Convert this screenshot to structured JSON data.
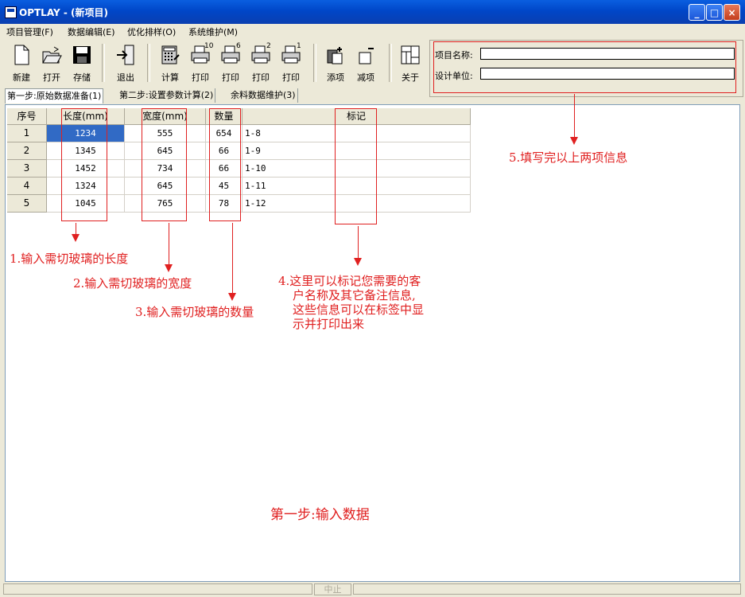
{
  "window": {
    "title": "OPTLAY - (新项目)"
  },
  "menu": [
    "项目管理(F)",
    "数据编辑(E)",
    "优化排样(O)",
    "系统维护(M)"
  ],
  "toolbar": {
    "new": "新建",
    "open": "打开",
    "save": "存储",
    "exit": "退出",
    "calc": "计算",
    "print1": "打印",
    "print2": "打印",
    "print3": "打印",
    "print4": "打印",
    "add": "添项",
    "remove": "减项",
    "about": "关于",
    "print_badges": [
      "10",
      "6",
      "2",
      "1"
    ]
  },
  "project": {
    "name_label": "项目名称:",
    "name_value": "",
    "unit_label": "设计单位:",
    "unit_value": ""
  },
  "tabs": [
    "第一步:原始数据准备(1)",
    "第二步:设置参数计算(2)",
    "余料数据维护(3)"
  ],
  "table": {
    "headers": [
      "序号",
      "长度(mm)",
      "宽度(mm)",
      "数量",
      "",
      "标记"
    ],
    "rows": [
      [
        "1",
        "1234",
        "555",
        "654",
        "1-8",
        ""
      ],
      [
        "2",
        "1345",
        "645",
        "66",
        "1-9",
        ""
      ],
      [
        "3",
        "1452",
        "734",
        "66",
        "1-10",
        ""
      ],
      [
        "4",
        "1324",
        "645",
        "45",
        "1-11",
        ""
      ],
      [
        "5",
        "1045",
        "765",
        "78",
        "1-12",
        ""
      ]
    ]
  },
  "annotations": {
    "length": "1.输入需切玻璃的长度",
    "width": "2.输入需切玻璃的宽度",
    "qty": "3.输入需切玻璃的数量",
    "mark_lines": [
      "4.这里可以标记您需要的客",
      "户名称及其它备注信息,",
      "这些信息可以在标签中显",
      "示并打印出来"
    ],
    "project": "5.填写完以上两项信息",
    "step": "第一步:输入数据"
  },
  "status": {
    "stop": "中止"
  },
  "colors": {
    "annotation": "#e02020",
    "titlebar": "#0a3fb0",
    "selection": "#316ac5"
  }
}
